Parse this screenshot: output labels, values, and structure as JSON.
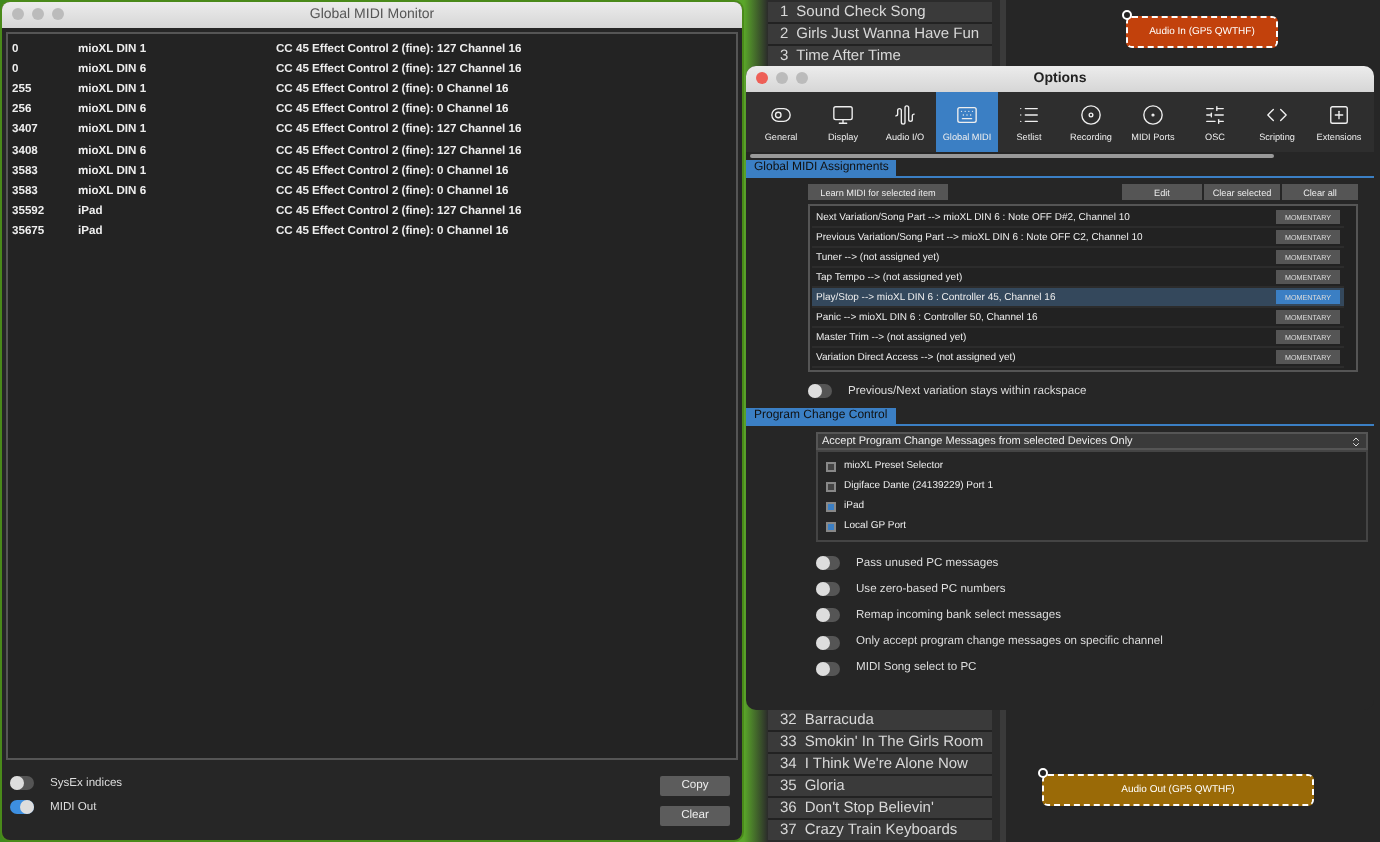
{
  "background_app": {
    "songs_top": [
      {
        "number": "1",
        "title": "Sound Check Song"
      },
      {
        "number": "2",
        "title": "Girls Just Wanna Have Fun"
      },
      {
        "number": "3",
        "title": "Time After Time"
      }
    ],
    "songs_bottom": [
      {
        "number": "32",
        "title": "Barracuda"
      },
      {
        "number": "33",
        "title": "Smokin' In The Girls Room"
      },
      {
        "number": "34",
        "title": "I Think We're Alone Now"
      },
      {
        "number": "35",
        "title": "Gloria"
      },
      {
        "number": "36",
        "title": "Don't Stop Believin'"
      },
      {
        "number": "37",
        "title": "Crazy Train Keyboards"
      }
    ],
    "blocks": [
      {
        "label": "Audio In (GP5 QWTHF)",
        "color": "#c2410c"
      },
      {
        "label": "Audio Out (GP5 QWTHF)",
        "color": "#9a6a07"
      }
    ]
  },
  "monitor": {
    "title": "Global MIDI Monitor",
    "rows": [
      {
        "time": "0",
        "device": "mioXL DIN 1",
        "message": "CC 45 Effect Control 2 (fine): 127 Channel 16"
      },
      {
        "time": "0",
        "device": "mioXL DIN 6",
        "message": "CC 45 Effect Control 2 (fine): 127 Channel 16"
      },
      {
        "time": "255",
        "device": "mioXL DIN 1",
        "message": "CC 45 Effect Control 2 (fine): 0 Channel 16"
      },
      {
        "time": "256",
        "device": "mioXL DIN 6",
        "message": "CC 45 Effect Control 2 (fine): 0 Channel 16"
      },
      {
        "time": "3407",
        "device": "mioXL DIN 1",
        "message": "CC 45 Effect Control 2 (fine): 127 Channel 16"
      },
      {
        "time": "3408",
        "device": "mioXL DIN 6",
        "message": "CC 45 Effect Control 2 (fine): 127 Channel 16"
      },
      {
        "time": "3583",
        "device": "mioXL DIN 1",
        "message": "CC 45 Effect Control 2 (fine): 0 Channel 16"
      },
      {
        "time": "3583",
        "device": "mioXL DIN 6",
        "message": "CC 45 Effect Control 2 (fine): 0 Channel 16"
      },
      {
        "time": "35592",
        "device": "iPad",
        "message": "CC 45 Effect Control 2 (fine): 127 Channel 16"
      },
      {
        "time": "35675",
        "device": "iPad",
        "message": "CC 45 Effect Control 2 (fine): 0 Channel 16"
      }
    ],
    "toggles": [
      {
        "label": "SysEx indices",
        "on": false
      },
      {
        "label": "MIDI Out",
        "on": true
      }
    ],
    "buttons": [
      "Copy",
      "Clear"
    ]
  },
  "options": {
    "title": "Options",
    "tabs": [
      {
        "label": "General",
        "selected": false
      },
      {
        "label": "Display",
        "selected": false
      },
      {
        "label": "Audio I/O",
        "selected": false
      },
      {
        "label": "Global MIDI",
        "selected": true
      },
      {
        "label": "Setlist",
        "selected": false
      },
      {
        "label": "Recording",
        "selected": false
      },
      {
        "label": "MIDI Ports",
        "selected": false
      },
      {
        "label": "OSC",
        "selected": false
      },
      {
        "label": "Scripting",
        "selected": false
      },
      {
        "label": "Extensions",
        "selected": false
      }
    ],
    "assignments": {
      "header": "Global MIDI Assignments",
      "learn_button": "Learn MIDI for selected item",
      "buttons": [
        "Edit",
        "Clear selected",
        "Clear all"
      ],
      "items": [
        {
          "label": "Next Variation/Song Part --> mioXL DIN 6 : Note OFF D#2, Channel 10",
          "mode": "MOMENTARY",
          "selected": false
        },
        {
          "label": "Previous Variation/Song Part --> mioXL DIN 6 : Note OFF C2, Channel 10",
          "mode": "MOMENTARY",
          "selected": false
        },
        {
          "label": "Tuner --> (not assigned yet)",
          "mode": "MOMENTARY",
          "selected": false
        },
        {
          "label": "Tap Tempo --> (not assigned yet)",
          "mode": "MOMENTARY",
          "selected": false
        },
        {
          "label": "Play/Stop --> mioXL DIN 6 : Controller 45, Channel 16",
          "mode": "MOMENTARY",
          "selected": true
        },
        {
          "label": "Panic --> mioXL DIN 6 : Controller 50, Channel 16",
          "mode": "MOMENTARY",
          "selected": false
        },
        {
          "label": "Master Trim --> (not assigned yet)",
          "mode": "MOMENTARY",
          "selected": false
        },
        {
          "label": "Variation Direct Access --> (not assigned yet)",
          "mode": "MOMENTARY",
          "selected": false
        }
      ],
      "toggle": {
        "label": "Previous/Next variation stays within rackspace",
        "on": false
      }
    },
    "program_change": {
      "header": "Program Change Control",
      "dropdown": "Accept Program Change Messages from selected Devices Only",
      "devices": [
        {
          "label": "mioXL Preset Selector",
          "checked": false
        },
        {
          "label": "Digiface Dante (24139229) Port 1",
          "checked": false
        },
        {
          "label": "iPad",
          "checked": true
        },
        {
          "label": "Local GP Port",
          "checked": true
        }
      ],
      "toggles": [
        {
          "label": "Pass unused PC messages",
          "on": false
        },
        {
          "label": "Use zero-based PC numbers",
          "on": false
        },
        {
          "label": "Remap incoming bank select messages",
          "on": false
        },
        {
          "label": "Only accept program change messages on specific channel",
          "on": false
        },
        {
          "label": "MIDI Song select to PC",
          "on": false
        }
      ]
    }
  }
}
